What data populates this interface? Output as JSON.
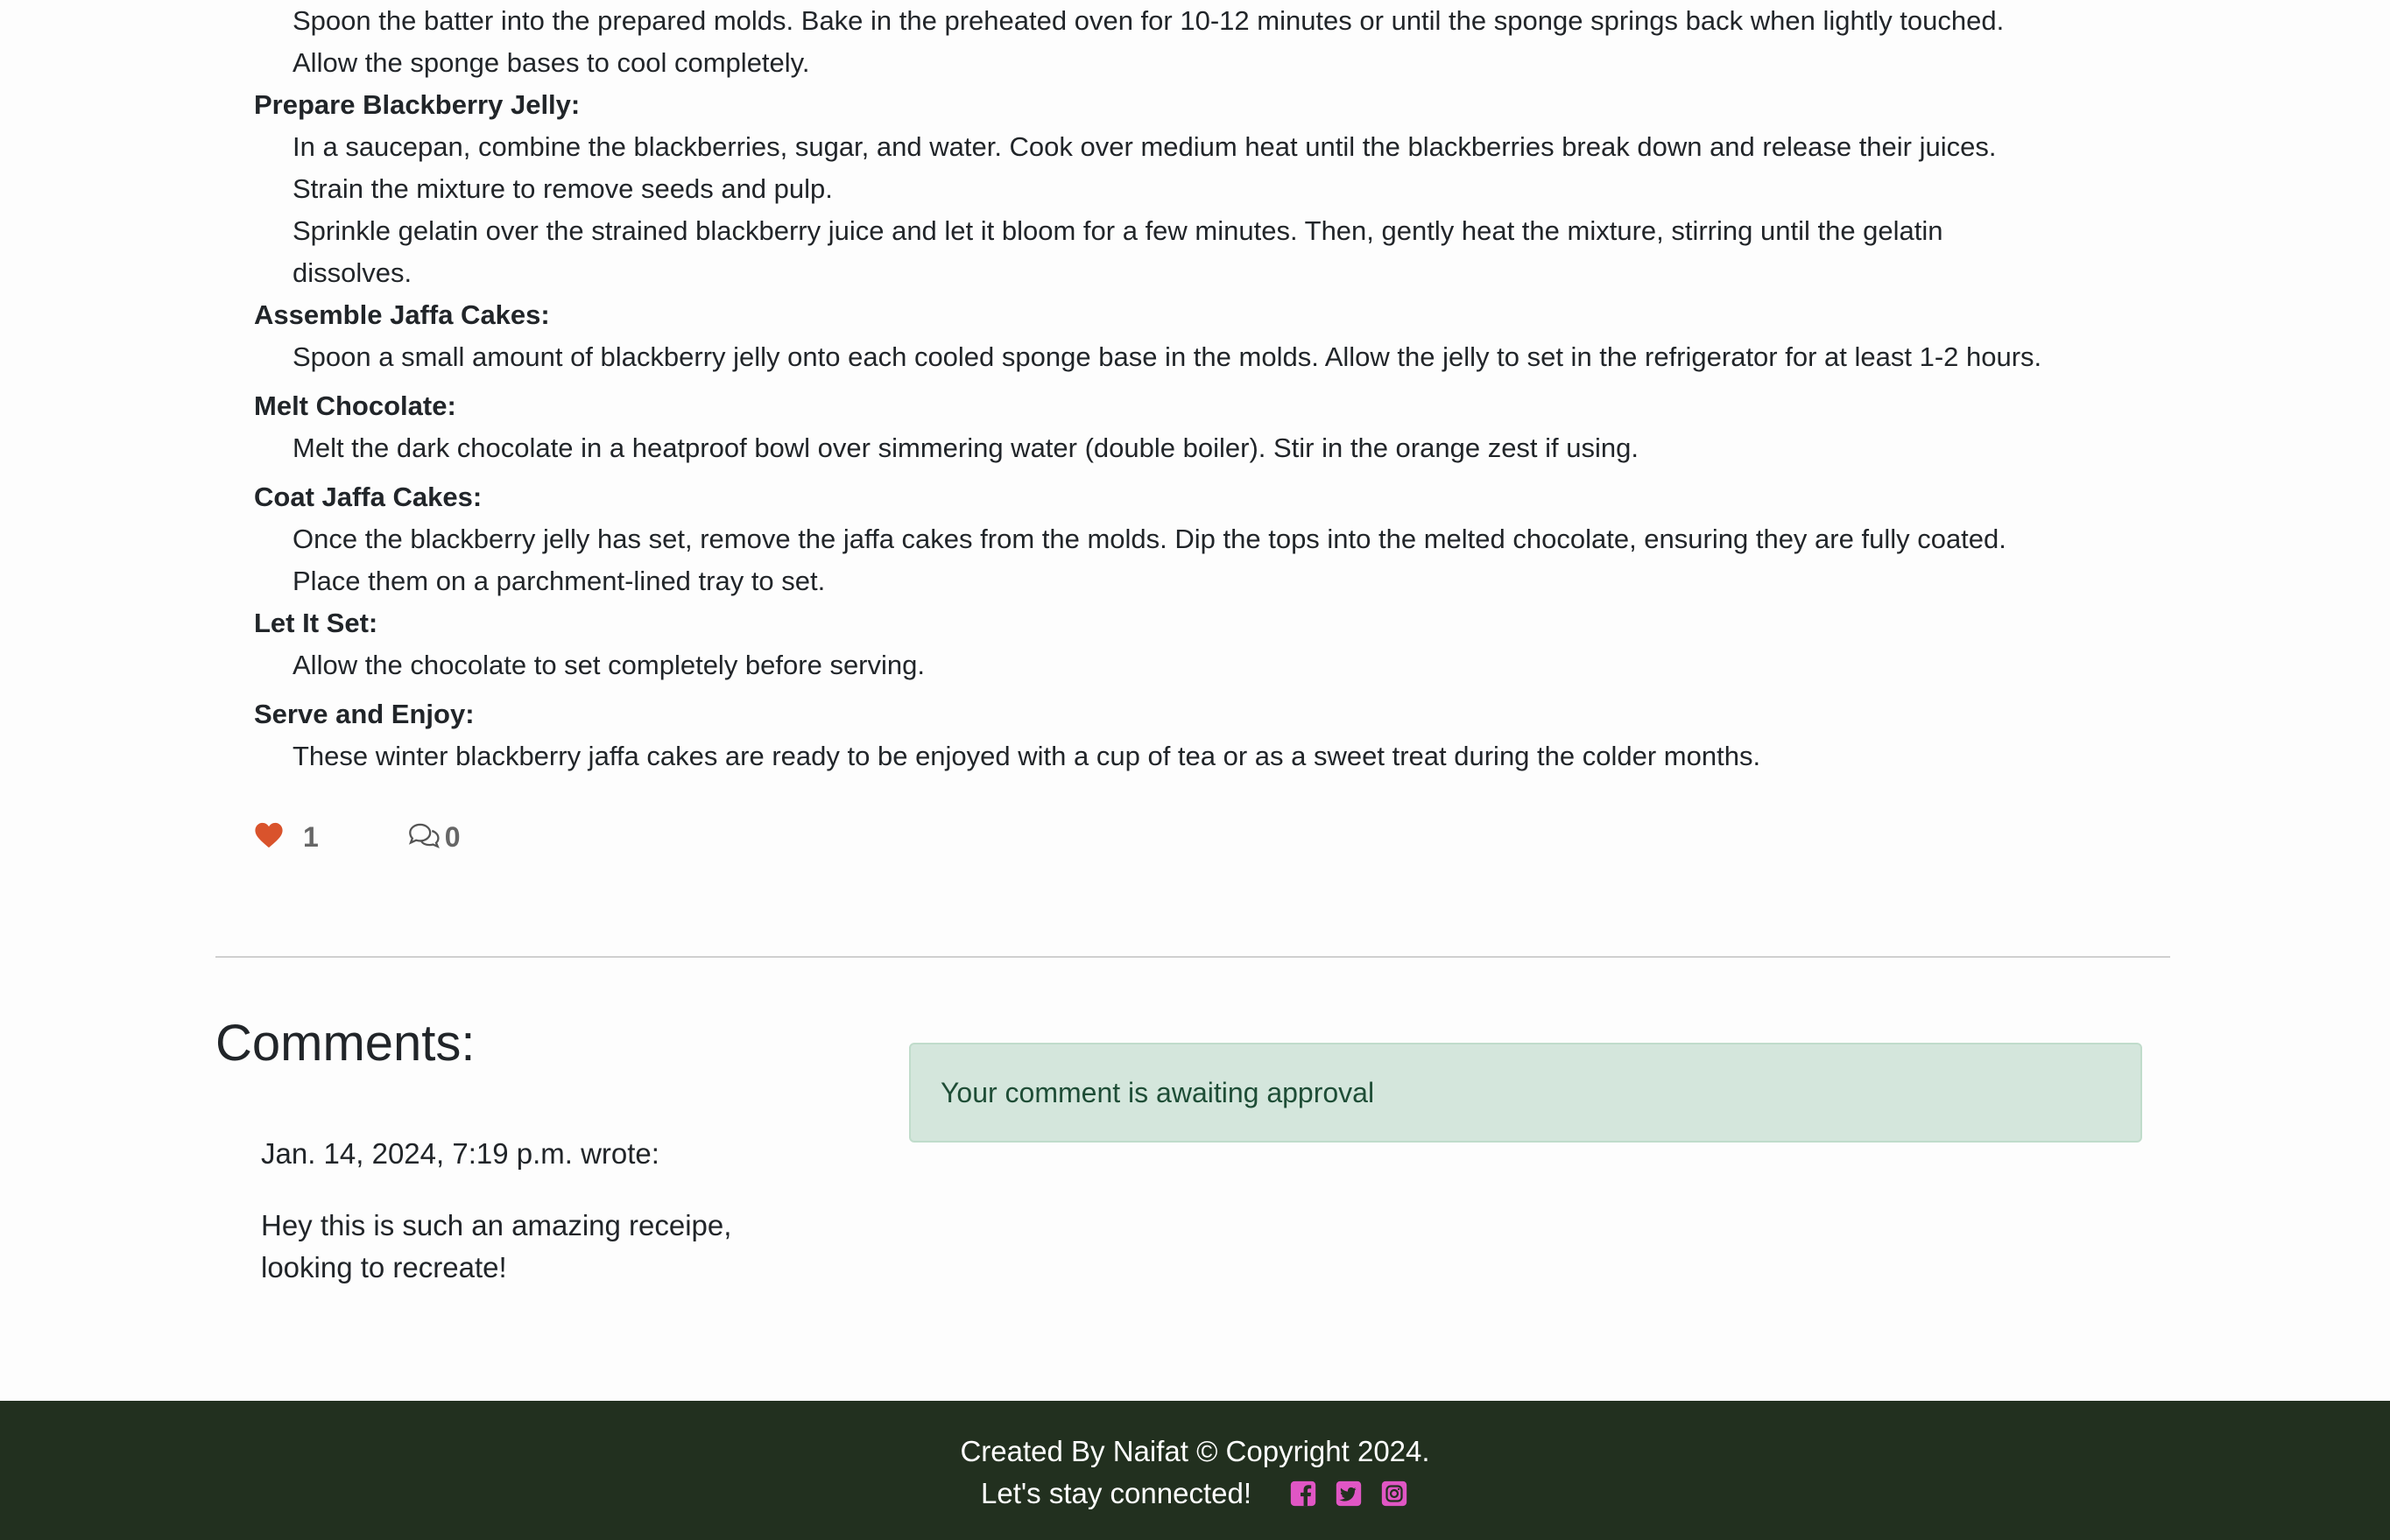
{
  "method_steps": [
    {
      "title": "",
      "lines": [
        "Spoon the batter into the prepared molds. Bake in the preheated oven for 10-12 minutes or until the sponge springs back when lightly touched.",
        "Allow the sponge bases to cool completely."
      ]
    },
    {
      "title": "Prepare Blackberry Jelly:",
      "lines": [
        "In a saucepan, combine the blackberries, sugar, and water. Cook over medium heat until the blackberries break down and release their juices.",
        "Strain the mixture to remove seeds and pulp.",
        "Sprinkle gelatin over the strained blackberry juice and let it bloom for a few minutes. Then, gently heat the mixture, stirring until the gelatin",
        "dissolves."
      ]
    },
    {
      "title": "Assemble Jaffa Cakes:",
      "lines": [
        "Spoon a small amount of blackberry jelly onto each cooled sponge base in the molds. Allow the jelly to set in the refrigerator for at least 1-2 hours."
      ]
    },
    {
      "title": "Melt Chocolate:",
      "lines": [
        "Melt the dark chocolate in a heatproof bowl over simmering water (double boiler). Stir in the orange zest if using."
      ]
    },
    {
      "title": "Coat Jaffa Cakes:",
      "lines": [
        "Once the blackberry jelly has set, remove the jaffa cakes from the molds. Dip the tops into the melted chocolate, ensuring they are fully coated.",
        "Place them on a parchment-lined tray to set."
      ]
    },
    {
      "title": "Let It Set:",
      "lines": [
        "Allow the chocolate to set completely before serving."
      ]
    },
    {
      "title": "Serve and Enjoy:",
      "lines": [
        "These winter blackberry jaffa cakes are ready to be enjoyed with a cup of tea or as a sweet treat during the colder months."
      ]
    }
  ],
  "reactions": {
    "like_count": "1",
    "comment_count": "0",
    "like_icon": "heart-icon",
    "comment_icon": "chat-icon",
    "heart_color": "#d9532c"
  },
  "comments": {
    "heading": "Comments:",
    "items": [
      {
        "meta": "Jan. 14, 2024, 7:19 p.m. wrote:",
        "body_lines": [
          "Hey this is such an amazing receipe,",
          "looking to recreate!"
        ]
      }
    ],
    "alert": "Your comment is awaiting approval"
  },
  "footer": {
    "line1": "Created By Naifat © Copyright 2024.",
    "line2": "Let's stay connected!",
    "social_icons": [
      "facebook-icon",
      "twitter-icon",
      "instagram-icon"
    ],
    "social_color": "#e056c4",
    "background": "#22301f"
  }
}
